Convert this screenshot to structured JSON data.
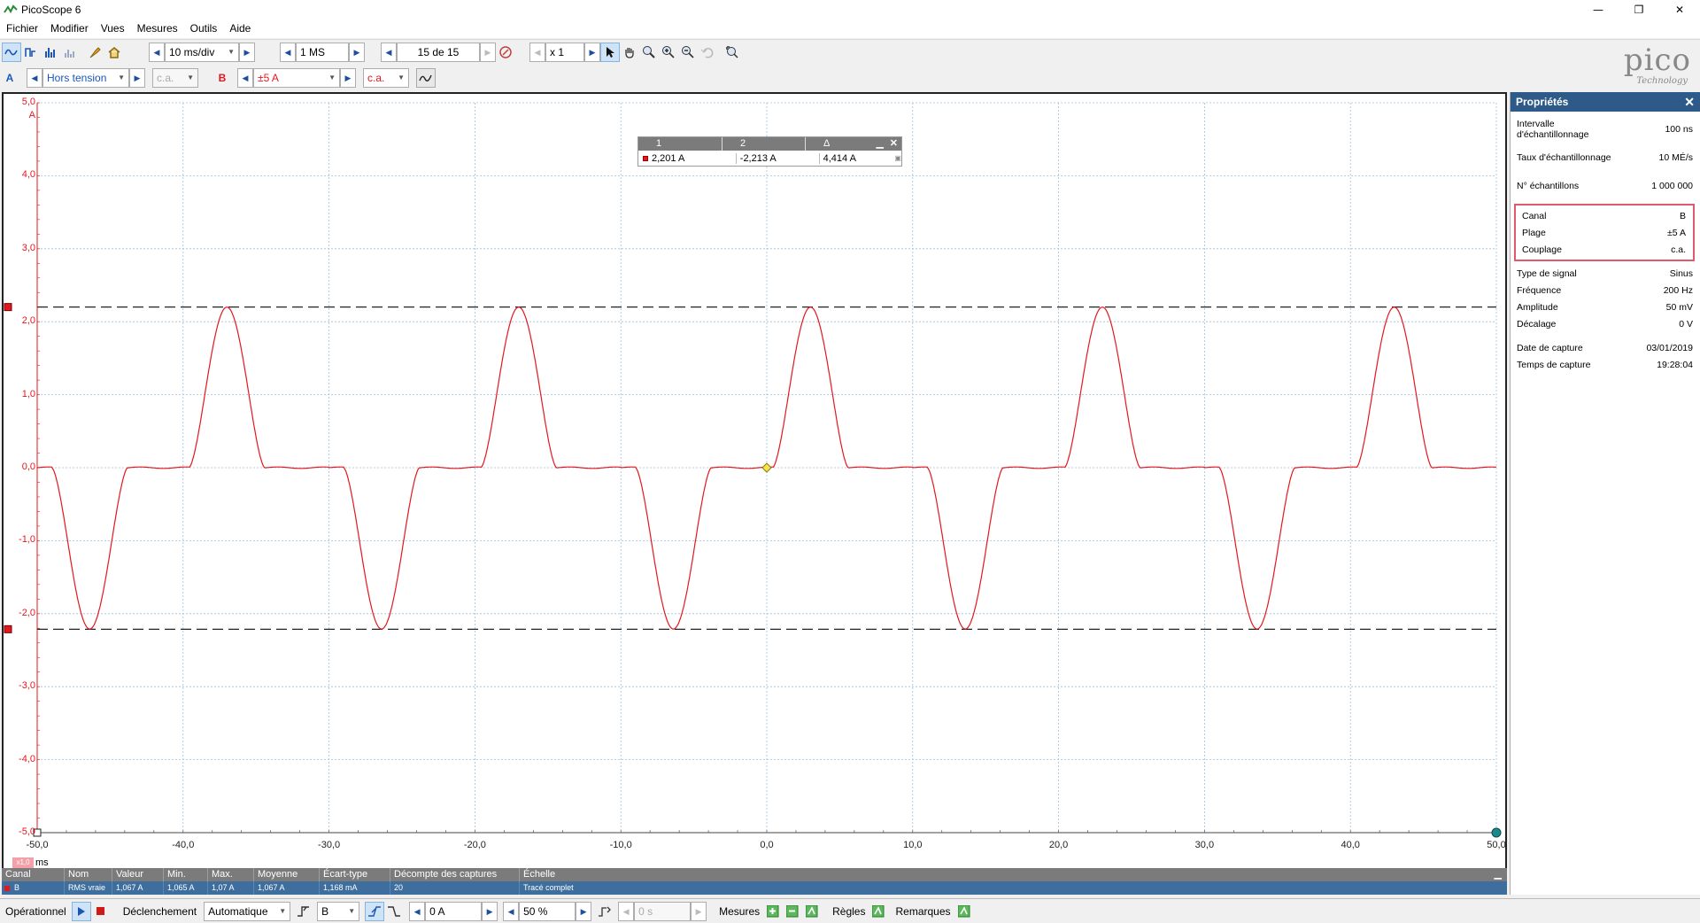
{
  "window": {
    "title": "PicoScope 6",
    "minimize": "—",
    "maximize": "❐",
    "close": "✕"
  },
  "menu": [
    "Fichier",
    "Modifier",
    "Vues",
    "Mesures",
    "Outils",
    "Aide"
  ],
  "toolbar": {
    "timebase": "10 ms/div",
    "samples": "1 MS",
    "capture": "15 de 15",
    "zoom": "x 1"
  },
  "channels": {
    "a_label": "A",
    "a_range": "Hors tension",
    "a_coupling": "c.a.",
    "b_label": "B",
    "b_range": "±5 A",
    "b_coupling": "c.a."
  },
  "logo": {
    "name": "pico",
    "sub": "Technology"
  },
  "ruler": {
    "h1": "1",
    "h2": "2",
    "hd": "Δ",
    "v1": "2,201 A",
    "v2": "-2,213 A",
    "vd": "4,414 A"
  },
  "chart_data": {
    "type": "line",
    "ylabel": "A",
    "xlabel": "ms",
    "xlim": [
      -50,
      50
    ],
    "ylim": [
      -5,
      5
    ],
    "grid": true,
    "x_ticks": [
      "-50,0",
      "-40,0",
      "-30,0",
      "-20,0",
      "-10,0",
      "0,0",
      "10,0",
      "20,0",
      "30,0",
      "40,0",
      "50,0"
    ],
    "y_ticks": [
      "5,0",
      "4,0",
      "3,0",
      "2,0",
      "1,0",
      "0,0",
      "-1,0",
      "-2,0",
      "-3,0",
      "-4,0",
      "-5,0"
    ],
    "series": [
      {
        "color": "#e3171e",
        "frequency_hz": 50,
        "peak": 2.2,
        "trough": -2.21
      }
    ],
    "rulers_y": [
      2.201,
      -2.213
    ],
    "trigger": {
      "x": 0,
      "y": 0
    },
    "zoom_badge": "x1,0"
  },
  "properties": {
    "title": "Propriétés",
    "rows1": [
      {
        "k": "Intervalle d'échantillonnage",
        "v": "100 ns"
      },
      {
        "k": "Taux d'échantillonnage",
        "v": "10 MÉ/s"
      },
      {
        "k": "N° échantillons",
        "v": "1 000 000"
      }
    ],
    "rows_ch": [
      {
        "k": "Canal",
        "v": "B"
      },
      {
        "k": "Plage",
        "v": "±5 A"
      },
      {
        "k": "Couplage",
        "v": "c.a."
      }
    ],
    "rows2": [
      {
        "k": "Type de signal",
        "v": "Sinus"
      },
      {
        "k": "Fréquence",
        "v": "200 Hz"
      },
      {
        "k": "Amplitude",
        "v": "50 mV"
      },
      {
        "k": "Décalage",
        "v": "0 V"
      }
    ],
    "rows3": [
      {
        "k": "Date de capture",
        "v": "03/01/2019"
      },
      {
        "k": "Temps de capture",
        "v": "19:28:04"
      }
    ]
  },
  "measurements": {
    "headers": [
      "Canal",
      "Nom",
      "Valeur",
      "Min.",
      "Max.",
      "Moyenne",
      "Écart-type",
      "Décompte des captures",
      "Échelle"
    ],
    "row": [
      "B",
      "RMS vraie",
      "1,067 A",
      "1,065 A",
      "1,07 A",
      "1,067 A",
      "1,168 mA",
      "20",
      "Tracé complet"
    ]
  },
  "status": {
    "run": "Opérationnel",
    "trigger_label": "Déclenchement",
    "trigger_mode": "Automatique",
    "trigger_channel": "B",
    "trigger_level": "0 A",
    "pretrigger": "50 %",
    "delay": "0 s",
    "measures": "Mesures",
    "rules": "Règles",
    "notes": "Remarques"
  }
}
